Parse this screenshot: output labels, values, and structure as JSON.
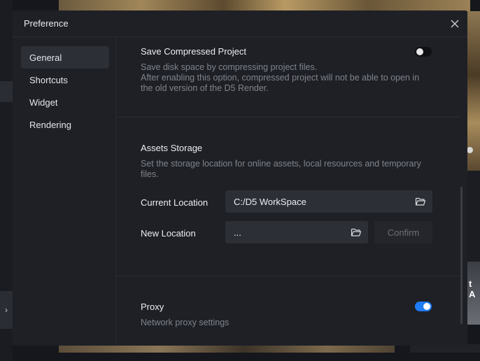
{
  "background": {
    "right_card_text": "t A",
    "left_arrow": "›"
  },
  "dialog": {
    "title": "Preference",
    "close_icon": "close-icon"
  },
  "sidebar": {
    "items": [
      {
        "label": "General",
        "active": true
      },
      {
        "label": "Shortcuts",
        "active": false
      },
      {
        "label": "Widget",
        "active": false
      },
      {
        "label": "Rendering",
        "active": false
      }
    ]
  },
  "general": {
    "compressed": {
      "title": "Save Compressed Project",
      "desc_line1": "Save disk space by compressing project files.",
      "desc_line2": "After enabling this option, compressed project will not be able to open in",
      "desc_line3": "the old version of the D5 Render.",
      "enabled": false
    },
    "assets_storage": {
      "title": "Assets Storage",
      "desc_line1": "Set the storage location for online assets, local resources and temporary",
      "desc_line2": "files.",
      "current_label": "Current Location",
      "current_value": "C:/D5 WorkSpace",
      "new_label": "New Location",
      "new_value": "...",
      "confirm_label": "Confirm"
    },
    "proxy": {
      "title": "Proxy",
      "desc": "Network proxy settings",
      "enabled": true
    }
  },
  "colors": {
    "accent": "#1f7cf5",
    "dialog_bg": "#1e2026",
    "field_bg": "#2c2f36"
  }
}
